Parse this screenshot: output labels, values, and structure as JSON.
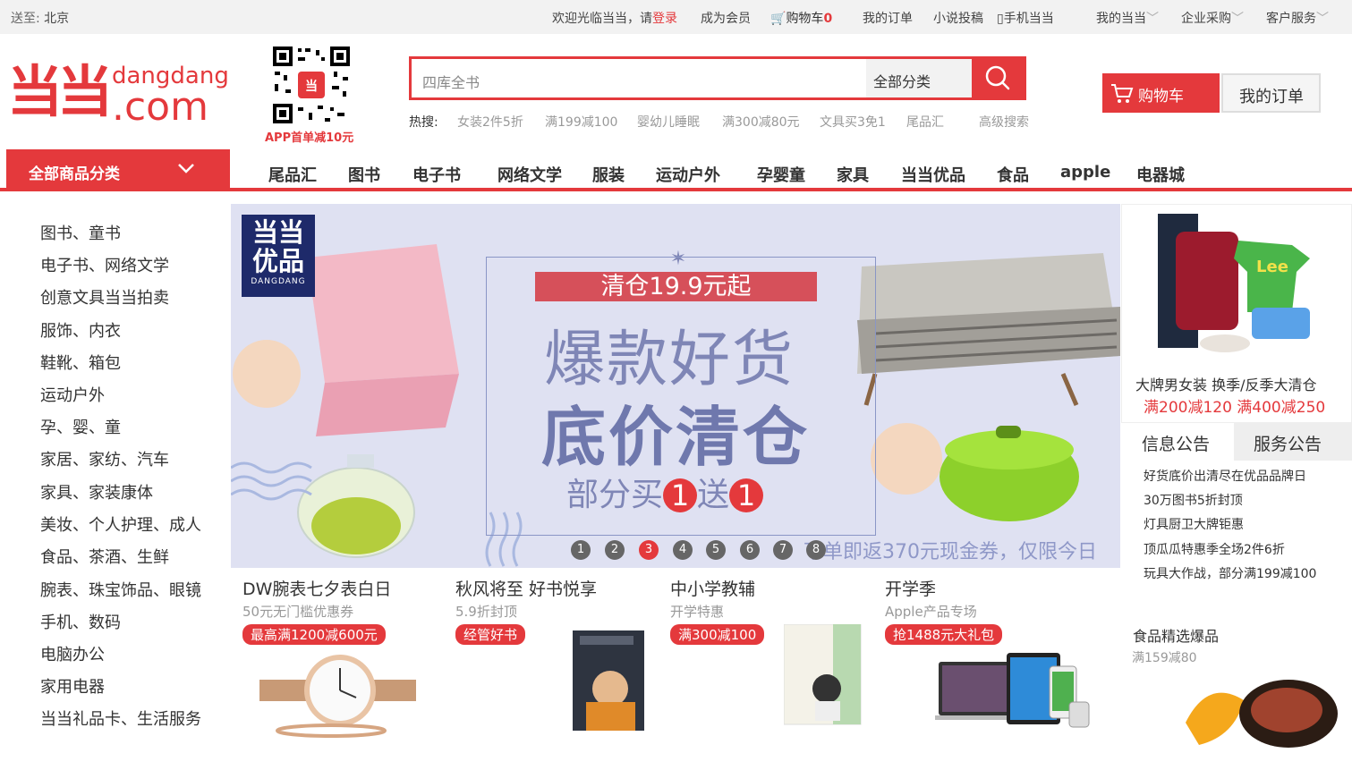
{
  "topbar": {
    "deliver_label": "送至:",
    "deliver_city": "北京",
    "welcome": "欢迎光临当当，请",
    "login": "登录",
    "member": "成为会员",
    "cart": "购物车",
    "cart_count": "0",
    "my_orders": "我的订单",
    "novel": "小说投稿",
    "mobile": "手机当当",
    "my_dangdang": "我的当当",
    "enterprise": "企业采购",
    "service": "客户服务"
  },
  "logo": {
    "mark": "当当",
    "line1": "dangdang",
    "line2": ".com"
  },
  "qr_label": "APP首单减10元",
  "search": {
    "placeholder": "四库全书",
    "category": "全部分类",
    "hot_label": "热搜:",
    "hot": [
      "女装2件5折",
      "满199减100",
      "婴幼儿睡眠",
      "满300减80元",
      "文具买3免1",
      "尾品汇"
    ],
    "advanced": "高级搜索"
  },
  "header_buttons": {
    "cart": "购物车",
    "orders": "我的订单"
  },
  "all_categories": "全部商品分类",
  "nav": [
    "尾品汇",
    "图书",
    "电子书",
    "网络文学",
    "服装",
    "运动户外",
    "孕婴童",
    "家具",
    "当当优品",
    "食品",
    "apple",
    "电器城"
  ],
  "left_menu": [
    "图书、童书",
    "电子书、网络文学",
    "创意文具当当拍卖",
    "服饰、内衣",
    "鞋靴、箱包",
    "运动户外",
    "孕、婴、童",
    "家居、家纺、汽车",
    "家具、家装康体",
    "美妆、个人护理、成人",
    "食品、茶酒、生鲜",
    "腕表、珠宝饰品、眼镜",
    "手机、数码",
    "电脑办公",
    "家用电器",
    "当当礼品卡、生活服务"
  ],
  "banner": {
    "brand_a": "当当",
    "brand_b": "优品",
    "brand_c": "DANGDANG",
    "tag": "清仓19.9元起",
    "title1": "爆款好货",
    "title2": "底价清仓",
    "title3_pre": "部分买",
    "title3_n1": "1",
    "title3_mid": "送",
    "title3_n2": "1",
    "bottom_text": "下单即返370元现金券，仅限今日",
    "dots": [
      "1",
      "2",
      "3",
      "4",
      "5",
      "6",
      "7",
      "8"
    ],
    "active_dot": 3
  },
  "right_ad": {
    "title": "大牌男女装 换季/反季大清仓",
    "promo": "满200减120 满400减250"
  },
  "tabs": {
    "notice": "信息公告",
    "service": "服务公告"
  },
  "notices": [
    "好货底价出清尽在优品品牌日",
    "30万图书5折封顶",
    "灯具厨卫大牌钜惠",
    "顶瓜瓜特惠季全场2件6折",
    "玩具大作战，部分满199减100"
  ],
  "food": {
    "title": "食品精选爆品",
    "sub": "满159减80"
  },
  "promos": [
    {
      "title": "DW腕表七夕表白日",
      "sub": "50元无门槛优惠券",
      "badge": "最高满1200减600元"
    },
    {
      "title": "秋风将至 好书悦享",
      "sub": "5.9折封顶",
      "badge": "经管好书"
    },
    {
      "title": "中小学教辅",
      "sub": "开学特惠",
      "badge": "满300减100"
    },
    {
      "title": "开学季",
      "sub": "Apple产品专场",
      "badge": "抢1488元大礼包"
    }
  ],
  "colors": {
    "brand_red": "#e4393c",
    "banner_bg": "#dfe1f2",
    "banner_text": "#7f86b6"
  }
}
